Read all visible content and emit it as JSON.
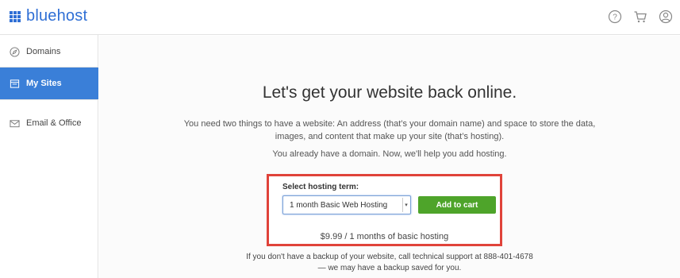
{
  "brand": {
    "name": "bluehost",
    "color": "#2f6fd5"
  },
  "top_icons": [
    "help-icon",
    "cart-icon",
    "account-icon"
  ],
  "sidebar": {
    "items": [
      {
        "label": "Domains",
        "icon": "compass-icon",
        "active": false
      },
      {
        "label": "My Sites",
        "icon": "sites-icon",
        "active": true
      },
      {
        "label": "Email & Office",
        "icon": "envelope-icon",
        "active": false
      }
    ]
  },
  "main": {
    "headline": "Let's get your website back online.",
    "intro": "You need two things to have a website: An address (that’s your domain name) and space to store the data, images, and content that make up your site (that’s hosting).",
    "domain_note": "You already have a domain. Now, we'll help you add hosting.",
    "hosting": {
      "label": "Select hosting term:",
      "selected": "1 month Basic Web Hosting",
      "add_button": "Add to cart",
      "price_text": "$9.99 / 1 months of basic hosting"
    },
    "backup_line1": "If you don't have a backup of your website, call technical support at 888-401-4678",
    "backup_line2": "— we may have a backup saved for you."
  },
  "colors": {
    "accent": "#3a7fd8",
    "button": "#4ea42a",
    "highlight_border": "#e0433a"
  }
}
